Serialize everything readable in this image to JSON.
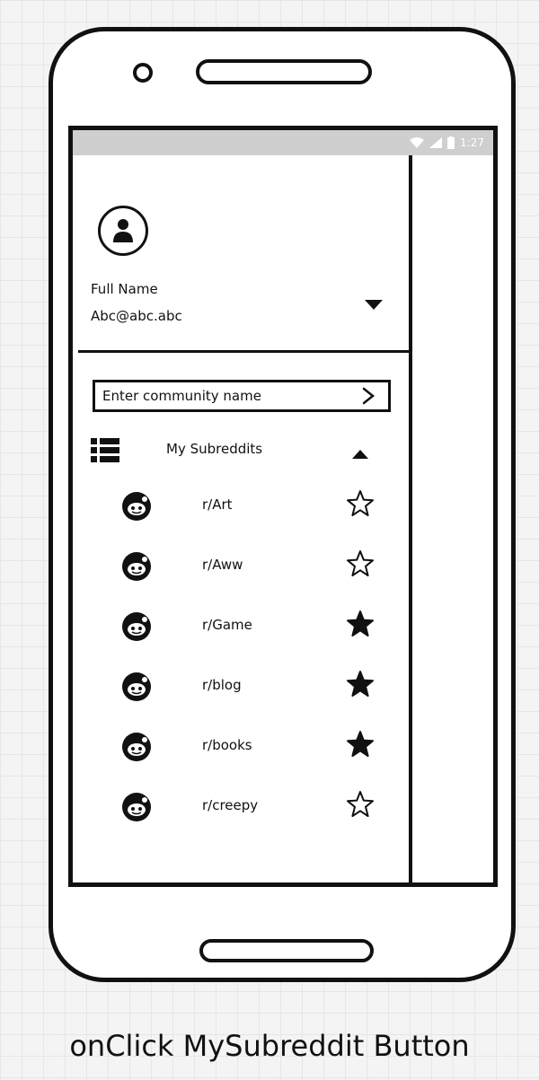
{
  "status_bar": {
    "time": "1:27",
    "icons": [
      "wifi-icon",
      "signal-icon",
      "battery-icon"
    ]
  },
  "drawer": {
    "profile": {
      "avatar_icon": "user-icon",
      "full_name": "Full Name",
      "email": "Abc@abc.abc",
      "toggle_icon": "caret-down-icon"
    },
    "search": {
      "placeholder": "Enter community name",
      "go_icon": "chevron-right-icon"
    },
    "my_subreddits": {
      "icon": "list-icon",
      "title": "My Subreddits",
      "expanded": true,
      "collapse_icon": "caret-up-icon",
      "items": [
        {
          "name": "r/Art",
          "icon": "reddit-alien-icon",
          "favorite": false
        },
        {
          "name": "r/Aww",
          "icon": "reddit-alien-icon",
          "favorite": false
        },
        {
          "name": "r/Game",
          "icon": "reddit-alien-icon",
          "favorite": true
        },
        {
          "name": "r/blog",
          "icon": "reddit-alien-icon",
          "favorite": true
        },
        {
          "name": "r/books",
          "icon": "reddit-alien-icon",
          "favorite": true
        },
        {
          "name": "r/creepy",
          "icon": "reddit-alien-icon",
          "favorite": false
        }
      ]
    }
  },
  "caption": "onClick MySubreddit Button",
  "colors": {
    "ink": "#111111",
    "status_bar": "#cfcfcf",
    "grid_background": "#f4f4f4"
  }
}
